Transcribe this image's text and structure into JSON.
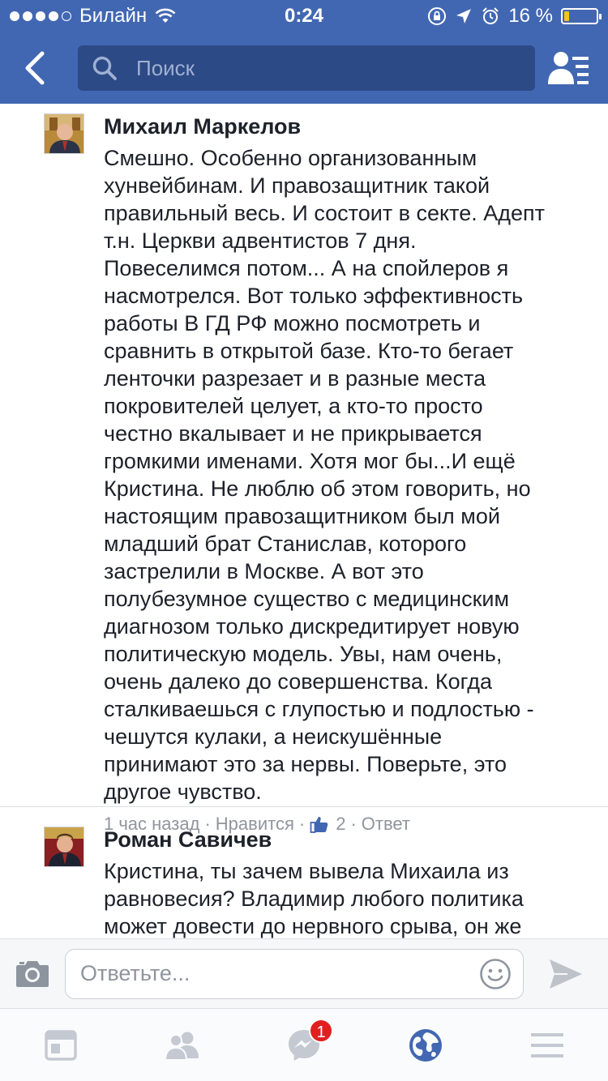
{
  "status_bar": {
    "carrier": "Билайн",
    "time": "0:24",
    "battery_percent": "16 %",
    "battery_level": 0.16,
    "battery_color": "#f5c518"
  },
  "nav": {
    "back_icon": "chevron-left-icon",
    "search_placeholder": "Поиск",
    "search_icon": "search-icon",
    "friends_icon": "friend-requests-icon"
  },
  "colors": {
    "header": "#4267b2",
    "search_bg": "#2c4a86",
    "like_blue": "#4267b2",
    "active_tab": "#4267b2",
    "inactive_tab": "#c4c9d2",
    "badge": "#e02020"
  },
  "comments": [
    {
      "author": "Михаил Маркелов",
      "text": "Смешно. Особенно организованным\nхунвейбинам. И правозащитник такой\nправильный весь. И состоит в секте. Адепт\nт.н. Церкви адвентистов 7 дня.\nПовеселимся потом... А на спойлеров я\nнасмотрелся. Вот только эффективность\nработы В ГД РФ можно посмотреть и\nсравнить в открытой базе. Кто-то бегает\nленточки разрезает и в разные места\nпокровителей целует, а кто-то просто\nчестно вкалывает и не прикрывается\nгромкими именами. Хотя мог бы...И ещё\nКристина. Не люблю об этом говорить, но\nнастоящим правозащитником был мой\nмладший брат Станислав, которого\nзастрелили в Москве. А вот это\nполубезумное существо с медицинским\nдиагнозом только дискредитирует новую\nполитическую модель. Увы, нам очень,\nочень далеко до совершенства. Когда\nсталкиваешься с глупостью и подлостью -\nчешутся кулаки, а неискушённые\nпринимают это за нервы. Поверьте, это\nдругое чувство.",
      "time": "1 час назад",
      "like_label": "Нравится",
      "like_count": "2",
      "reply_label": "Ответ",
      "sep": "·"
    },
    {
      "author": "Роман Савичев",
      "text": "Кристина, ты зачем вывела Михаила из\nравновесия? Владимир любого политика\nможет довести до нервного срыва, он же\nпсихолог и экстрасенс."
    }
  ],
  "reply_bar": {
    "placeholder": "Ответьте...",
    "camera_icon": "camera-icon",
    "emoji_icon": "emoji-icon",
    "send_icon": "send-icon"
  },
  "tabbar": {
    "tabs": [
      {
        "icon": "news-feed-icon"
      },
      {
        "icon": "friends-icon"
      },
      {
        "icon": "messenger-icon",
        "badge": "1"
      },
      {
        "icon": "notifications-globe-icon",
        "active": true
      },
      {
        "icon": "menu-icon"
      }
    ]
  }
}
